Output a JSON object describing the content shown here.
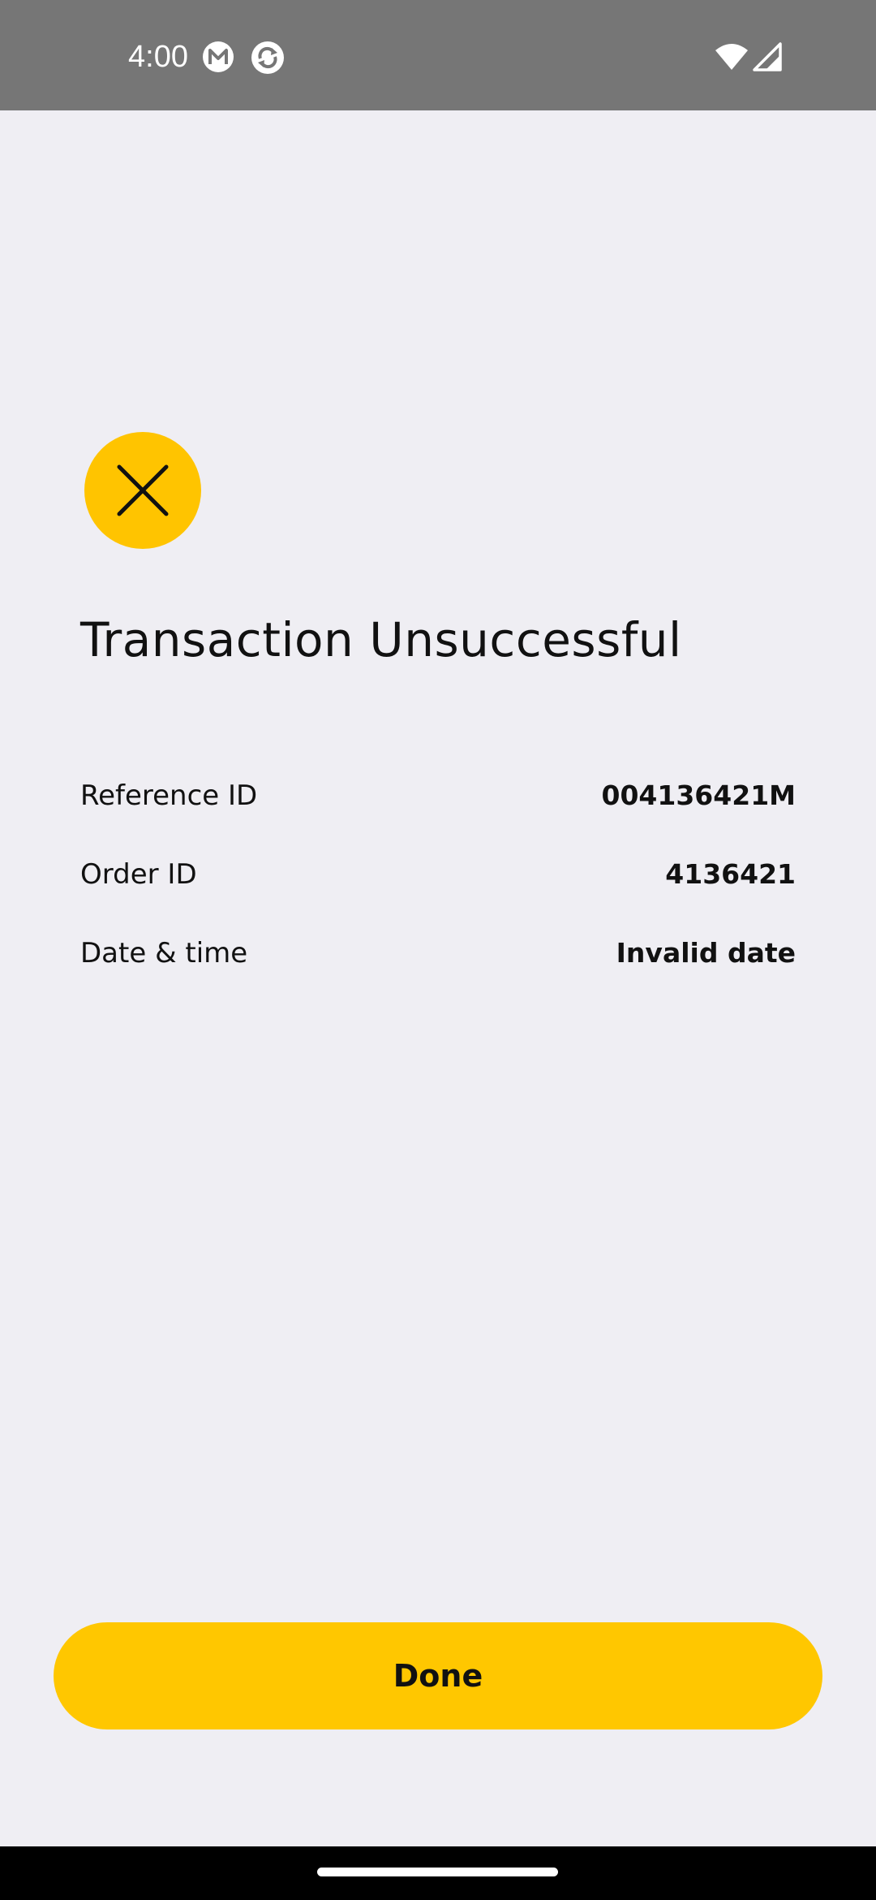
{
  "status_bar": {
    "time": "4:00",
    "icons": [
      "m-app-icon",
      "sync-app-icon",
      "wifi-icon",
      "cellular-signal-icon"
    ]
  },
  "result": {
    "icon": "close-icon",
    "icon_color": "#FFC400",
    "title": "Transaction Unsuccessful"
  },
  "details": [
    {
      "label": "Reference ID",
      "value": "004136421M"
    },
    {
      "label": "Order ID",
      "value": "4136421"
    },
    {
      "label": "Date & time",
      "value": "Invalid date"
    }
  ],
  "actions": {
    "done_label": "Done",
    "button_color": "#FFC700"
  },
  "navigation": {
    "home_indicator": "home-pill"
  }
}
